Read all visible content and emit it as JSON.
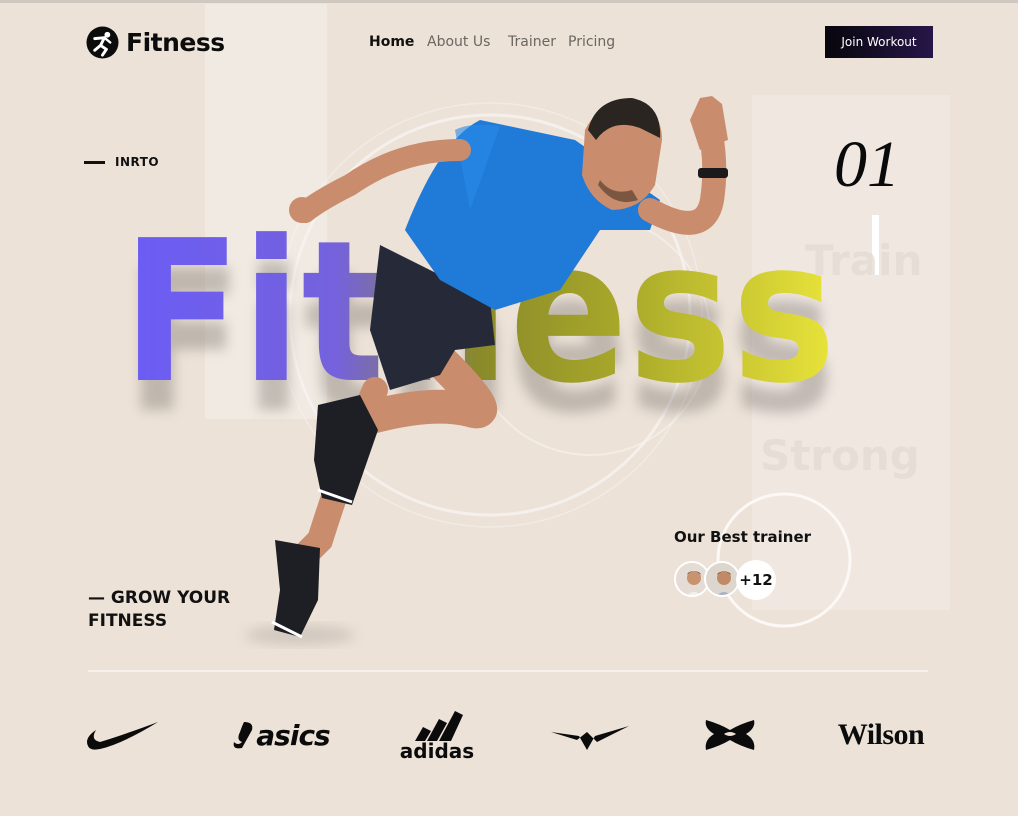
{
  "header": {
    "logo_text": "Fitness",
    "nav": [
      {
        "label": "Home",
        "active": true
      },
      {
        "label": "About Us",
        "active": false
      },
      {
        "label": "Trainer",
        "active": false
      },
      {
        "label": "Pricing",
        "active": false
      }
    ],
    "join_button": "Join Workout"
  },
  "hero": {
    "intro_label": "INRTO",
    "big_title": "Fitness",
    "slide_number": "01",
    "gradient_colors": [
      "#6b5cf6",
      "#e9e43a"
    ]
  },
  "trainers": {
    "label": "Our Best trainer",
    "extra_count": "+12"
  },
  "tagline": {
    "line1": "— GROW YOUR",
    "line2": "FITNESS"
  },
  "brands": [
    {
      "name": "nike",
      "label": ""
    },
    {
      "name": "asics",
      "label": "asics"
    },
    {
      "name": "adidas",
      "label": "adidas"
    },
    {
      "name": "mizuno",
      "label": ""
    },
    {
      "name": "under-armour",
      "label": ""
    },
    {
      "name": "wilson",
      "label": "Wilson"
    }
  ],
  "colors": {
    "background": "#ece2d8",
    "accent_purple": "#6b5cf6",
    "accent_yellow": "#e9e43a",
    "shirt_blue": "#1f7ad8",
    "button_dark": "#0d0b14"
  }
}
